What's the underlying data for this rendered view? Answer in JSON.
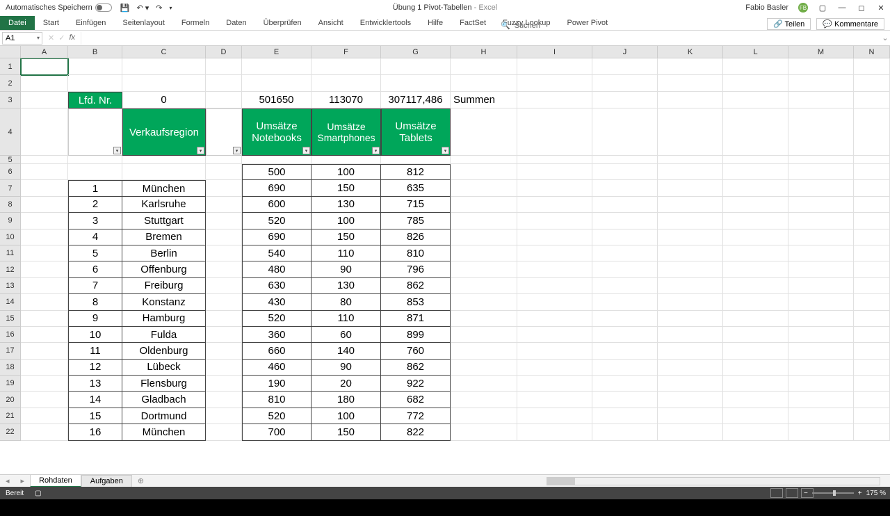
{
  "titlebar": {
    "autosave": "Automatisches Speichern",
    "doctitle": "Übung 1 Pivot-Tabellen",
    "app": "Excel",
    "user": "Fabio Basler",
    "avatar": "FB"
  },
  "ribbon": {
    "tabs": [
      "Datei",
      "Start",
      "Einfügen",
      "Seitenlayout",
      "Formeln",
      "Daten",
      "Überprüfen",
      "Ansicht",
      "Entwicklertools",
      "Hilfe",
      "FactSet",
      "Fuzzy Lookup",
      "Power Pivot"
    ],
    "search": "Suchen",
    "share": "Teilen",
    "comments": "Kommentare"
  },
  "namebox": "A1",
  "cols": [
    "A",
    "B",
    "C",
    "D",
    "E",
    "F",
    "G",
    "H",
    "I",
    "J",
    "K",
    "L",
    "M",
    "N"
  ],
  "row3": {
    "B": "Lfd. Nr.",
    "C": "0",
    "E": "501650",
    "F": "113070",
    "G": "307117,486",
    "H": "Summen"
  },
  "row4": {
    "C": "Verkaufsregion",
    "E": "Umsätze Notebooks",
    "F": "Umsätze Smartphones",
    "G": "Umsätze Tablets"
  },
  "data": [
    {
      "n": "",
      "city": "",
      "e": "500",
      "f": "100",
      "g": "812"
    },
    {
      "n": "1",
      "city": "München",
      "e": "690",
      "f": "150",
      "g": "635"
    },
    {
      "n": "2",
      "city": "Karlsruhe",
      "e": "600",
      "f": "130",
      "g": "715"
    },
    {
      "n": "3",
      "city": "Stuttgart",
      "e": "520",
      "f": "100",
      "g": "785"
    },
    {
      "n": "4",
      "city": "Bremen",
      "e": "690",
      "f": "150",
      "g": "826"
    },
    {
      "n": "5",
      "city": "Berlin",
      "e": "540",
      "f": "110",
      "g": "810"
    },
    {
      "n": "6",
      "city": "Offenburg",
      "e": "480",
      "f": "90",
      "g": "796"
    },
    {
      "n": "7",
      "city": "Freiburg",
      "e": "630",
      "f": "130",
      "g": "862"
    },
    {
      "n": "8",
      "city": "Konstanz",
      "e": "430",
      "f": "80",
      "g": "853"
    },
    {
      "n": "9",
      "city": "Hamburg",
      "e": "520",
      "f": "110",
      "g": "871"
    },
    {
      "n": "10",
      "city": "Fulda",
      "e": "360",
      "f": "60",
      "g": "899"
    },
    {
      "n": "11",
      "city": "Oldenburg",
      "e": "660",
      "f": "140",
      "g": "760"
    },
    {
      "n": "12",
      "city": "Lübeck",
      "e": "460",
      "f": "90",
      "g": "862"
    },
    {
      "n": "13",
      "city": "Flensburg",
      "e": "190",
      "f": "20",
      "g": "922"
    },
    {
      "n": "14",
      "city": "Gladbach",
      "e": "810",
      "f": "180",
      "g": "682"
    },
    {
      "n": "15",
      "city": "Dortmund",
      "e": "520",
      "f": "100",
      "g": "772"
    },
    {
      "n": "16",
      "city": "München",
      "e": "700",
      "f": "150",
      "g": "822"
    }
  ],
  "sheets": {
    "active": "Rohdaten",
    "other": "Aufgaben"
  },
  "status": {
    "ready": "Bereit",
    "zoom": "175 %"
  }
}
